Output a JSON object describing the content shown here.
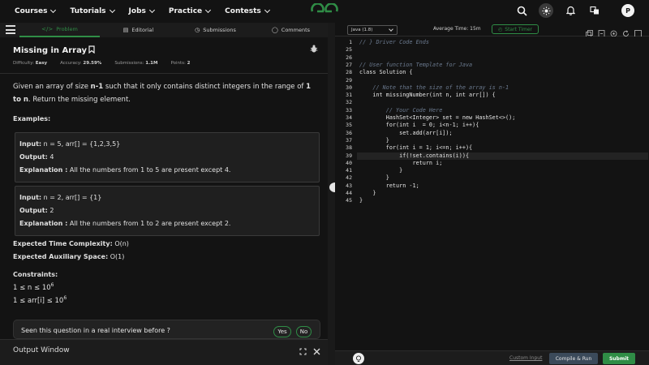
{
  "nav": {
    "items": [
      "Courses",
      "Tutorials",
      "Jobs",
      "Practice",
      "Contests"
    ],
    "avatar_letter": "P"
  },
  "tabs": {
    "problem": "Problem",
    "editorial": "Editorial",
    "submissions": "Submissions",
    "comments": "Comments"
  },
  "problem": {
    "title": "Missing in Array",
    "difficulty_label": "Difficulty:",
    "difficulty": "Easy",
    "accuracy_label": "Accuracy:",
    "accuracy": "29.59%",
    "submissions_label": "Submissions:",
    "submissions": "1.1M",
    "points_label": "Points:",
    "points": "2",
    "desc_1": "Given an array of size ",
    "desc_n1": "n-1",
    "desc_2": " such that it only contains distinct integers in the range of ",
    "desc_range": "1 to n",
    "desc_3": ". Return the missing element.",
    "examples_heading": "Examples:",
    "examples": [
      {
        "input_label": "Input:",
        "input": "n = 5, arr[] = {1,2,3,5}",
        "output_label": "Output:",
        "output": "4",
        "explanation_label": "Explanation :",
        "explanation": "All the numbers from 1 to 5 are present except 4."
      },
      {
        "input_label": "Input:",
        "input": "n = 2, arr[] = {1}",
        "output_label": "Output:",
        "output": "2",
        "explanation_label": "Explanation :",
        "explanation": "All the numbers from 1 to 2 are present except 2."
      }
    ],
    "time_label": "Expected Time Complexity:",
    "time": "O(n)",
    "space_label": "Expected Auxiliary Space:",
    "space": "O(1)",
    "constraints_heading": "Constraints:",
    "c1_base": "1 ≤ n ≤ 10",
    "c1_exp": "6",
    "c2_base": "1 ≤ arr[i] ≤ 10",
    "c2_exp": "6",
    "real_question": "Seen this question in a real interview before ?",
    "yes": "Yes",
    "no": "No",
    "output_window": "Output Window"
  },
  "editor": {
    "language": "Java (1.8)",
    "avg_time": "Average Time: 15m",
    "start_timer": "Start Timer",
    "lines": [
      {
        "n": "1",
        "t": "// } Driver Code Ends",
        "c": true
      },
      {
        "n": "25",
        "t": ""
      },
      {
        "n": "26",
        "t": ""
      },
      {
        "n": "27",
        "t": "// User function Template for Java",
        "c": true
      },
      {
        "n": "28",
        "t": "class Solution {"
      },
      {
        "n": "29",
        "t": ""
      },
      {
        "n": "30",
        "t": "    // Note that the size of the array is n-1",
        "c": true
      },
      {
        "n": "31",
        "t": "    int missingNumber(int n, int arr[]) {"
      },
      {
        "n": "32",
        "t": ""
      },
      {
        "n": "33",
        "t": "        // Your Code Here",
        "c": true
      },
      {
        "n": "34",
        "t": "        HashSet<Integer> set = new HashSet<>();"
      },
      {
        "n": "35",
        "t": "        for(int i  = 0; i<n-1; i++){"
      },
      {
        "n": "36",
        "t": "            set.add(arr[i]);"
      },
      {
        "n": "37",
        "t": "        }"
      },
      {
        "n": "38",
        "t": "        for(int i = 1; i<=n; i++){"
      },
      {
        "n": "39",
        "t": "            if(!set.contains(i)){"
      },
      {
        "n": "40",
        "t": "                return i;"
      },
      {
        "n": "41",
        "t": "            }"
      },
      {
        "n": "42",
        "t": "        }"
      },
      {
        "n": "43",
        "t": "        return -1;"
      },
      {
        "n": "44",
        "t": "    }"
      },
      {
        "n": "45",
        "t": "}"
      }
    ],
    "custom_input": "Custom Input",
    "compile_run": "Compile & Run",
    "submit": "Submit"
  },
  "colors": {
    "accent": "#2f8d46",
    "bg": "#131313"
  }
}
